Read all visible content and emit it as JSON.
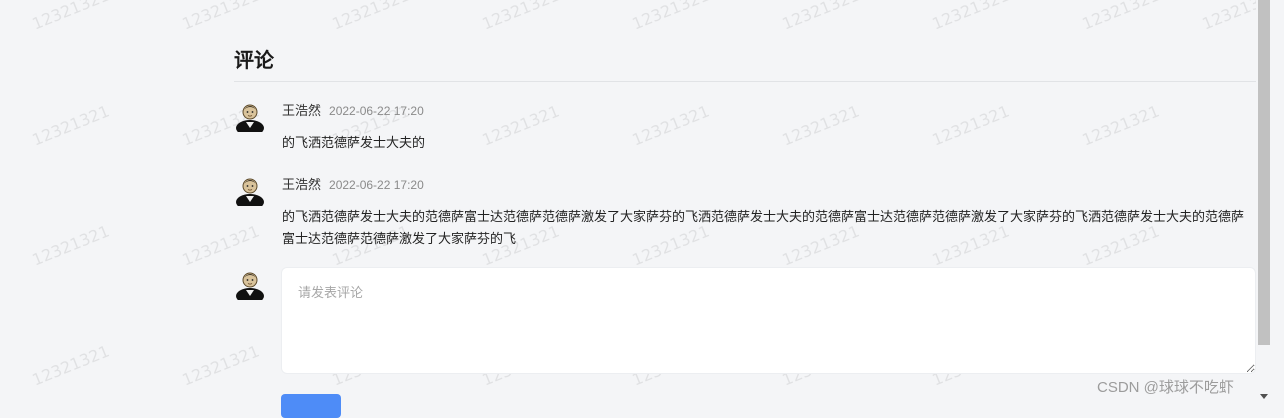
{
  "section": {
    "title": "评论"
  },
  "comments": [
    {
      "author": "王浩然",
      "time": "2022-06-22 17:20",
      "text": "的飞洒范德萨发士大夫的"
    },
    {
      "author": "王浩然",
      "time": "2022-06-22 17:20",
      "text": "的飞洒范德萨发士大夫的范德萨富士达范德萨范德萨激发了大家萨芬的飞洒范德萨发士大夫的范德萨富士达范德萨范德萨激发了大家萨芬的飞洒范德萨发士大夫的范德萨富士达范德萨范德萨激发了大家萨芬的飞"
    }
  ],
  "composer": {
    "placeholder": "请发表评论",
    "value": ""
  },
  "watermark": {
    "text": "12321321"
  },
  "credit": {
    "text": "CSDN @球球不吃虾"
  },
  "colors": {
    "background": "#f4f5f7",
    "accent": "#4e8cf7",
    "divider": "#e1e3e6"
  },
  "icons": {
    "avatar": "user-avatar-icon"
  }
}
